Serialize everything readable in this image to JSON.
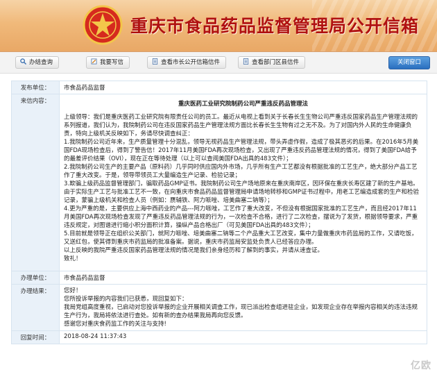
{
  "header": {
    "title": "重庆市食品药品监督管理局公开信箱"
  },
  "toolbar": {
    "buttons": [
      {
        "label": "办结查询"
      },
      {
        "label": "我要写信"
      },
      {
        "label": "查看市长公开信箱信件"
      },
      {
        "label": "查看部门区县信件"
      }
    ],
    "close_label": "关闭窗口"
  },
  "letter": {
    "sender_label": "发布单位：",
    "sender": "市食品药品监督",
    "content_label": "来信内容：",
    "title": "重庆医药工业研究院制药公司严重违反药品管理法",
    "paragraphs": [
      "上级领导：我们是重庆医药工业研究院有限责任公司的员工。最近从电视上看到关于长春长生生物公司严重违反国家药品生产管理法规的系列报道，我们认为，我院制药公司在违反国家药品生产管理法规方面比长春长生生物有过之无不及。为了对国内外人民的生命健康负责，特向上级机关反映如下，务请尽快调查纠正：",
      "1.我院制药公司近年来，生产质量管理十分混乱，领导无视药品生产管理法规，带头弄虚作假，造成了极其恶劣的后果。在2016年5月美国FDA现场检查后，得到了警告信！2017年11月美国FDA再次现场检查，又出现了严重违反药品管理法规的情况，得到了美国FDA给予的最差评价结果（OVI），现在正在等待处理（以上可以查阅美国FDA出具的483文件）；",
      "2.我院制药公司生产的主要产品（原料药）几乎同时供应国内外市场，几乎所有生产工艺都没有根据批准的工艺生产，绝大部分产品工艺作了重大改变。于是，领导带领员工大量编造生产记录、检验记录；",
      "3.欺骗上级药品监督管理部门，骗取药品GMP证书。我院制药公司生产场地原来在重庆南岸区，因环保在重庆长寿区建了新的生产基地。由于实际生产工艺与批准工艺不一致，在向重庆市食品药品监督管理局申请场地转移和GMP证书过程中，用老工艺编造成套的生产和检验记录，蒙骗上级机关和检查人员（例如：赝辅铁、阿力哌唑、培美曲塞二钠等）；",
      "4.更为严重的是，主要供应上海中西药业的产品---阿力哌唑，工艺作了重大改变，不但没有根据国家批准的工艺生产，而且经2017年11月美国FDA再次现场检查发现了严重违反药品管理法规的行为，一次检查不合格，进行了二次检查，摆说为了发货，根据领导要求，严重违反规定，对图谱进行缩小积分面积计算，操纵产品合格出厂（可见美国FDA出具的483文件）；",
      "5.目前就是领导正在组织公关部门，就阿力哌唑、培美曲塞二钠等二个产品重大工艺改变，集中力量做重庆市药监局的工作，又请吃饭，又送红包，使其得到重庆市药监局的批准备案。据说，重庆市药监局安监处负责人已经答应办理。",
      "以上反映的我院严重违反国家药品管理法规的情况是我们亲身经历和了解到的事实，并请从速查证。",
      "致礼！"
    ]
  },
  "reply": {
    "handler_label": "办理单位：",
    "handler": "市食品药品监督",
    "result_label": "办理结果：",
    "lines": [
      "您好！",
      "您所投诉举报的内容我们已获悉，现回复如下：",
      "我局党组高度重视，已启动对您投诉举报的企业开展相关调查工作，现已派出检查组进驻企业，如发现企业存在举报内容相关的违法违规生产行为，我局将依法进行查处。如有新的查办结果我局再向您反馈。",
      "感谢您对重庆食药监工作的关注与支持!"
    ],
    "time_label": "回复时间：",
    "time": "2018-08-24 11:37:43"
  },
  "watermark": "亿欧"
}
